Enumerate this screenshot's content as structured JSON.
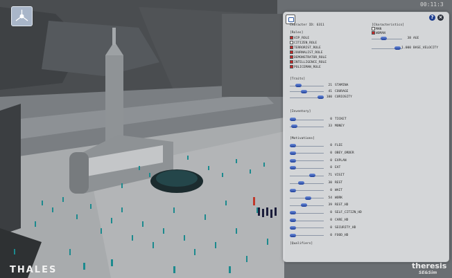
{
  "overlay": {
    "clock": "00:11:3",
    "bottom_left_logo": "THALES",
    "bottom_right_logo": "theresis",
    "bottom_right_sub": "SE&Sim"
  },
  "panel": {
    "character_id": "Character ID: 6311",
    "help_icon": "?",
    "close_icon": "×",
    "roles_header": "[Roles]",
    "roles": [
      {
        "label": "VIP_ROLE",
        "checked": true
      },
      {
        "label": "CITIZEN_ROLE",
        "checked": false
      },
      {
        "label": "TERRORIST_ROLE",
        "checked": true
      },
      {
        "label": "JOURNALIST_ROLE",
        "checked": true
      },
      {
        "label": "DEMONSTRATOR_ROLE",
        "checked": true
      },
      {
        "label": "INTELLIGENCE_ROLE",
        "checked": true
      },
      {
        "label": "POLICEMAN_ROLE",
        "checked": true
      }
    ],
    "characteristics_header": "[Characteristics]",
    "genders": [
      {
        "label": "MAN",
        "checked": false
      },
      {
        "label": "WOMAN",
        "checked": true
      }
    ],
    "characteristics": [
      {
        "label": "AGE",
        "value": "38",
        "level": 0.38
      },
      {
        "label": "BASE_VELOCITY",
        "value": "1.000",
        "level": 0.95
      }
    ],
    "traits_header": "[Traits]",
    "traits": [
      {
        "label": "STAMINA",
        "value": "21",
        "level": 0.21
      },
      {
        "label": "COURAGE",
        "value": "41",
        "level": 0.41
      },
      {
        "label": "CURIOSITY",
        "value": "100",
        "level": 1.0
      }
    ],
    "inventory_header": "[Inventory]",
    "inventory": [
      {
        "label": "TICKET",
        "value": "0",
        "level": 0.0
      },
      {
        "label": "MONEY",
        "value": "33",
        "level": 0.05
      }
    ],
    "motivations_header": "[Motivations]",
    "motivations": [
      {
        "label": "FLEE",
        "value": "0",
        "level": 0.0
      },
      {
        "label": "OBEY_ORDER",
        "value": "0",
        "level": 0.0
      },
      {
        "label": "EXPLAN",
        "value": "0",
        "level": 0.0
      },
      {
        "label": "EAT",
        "value": "0",
        "level": 0.0
      },
      {
        "label": "VISIT",
        "value": "71",
        "level": 0.71
      },
      {
        "label": "REST",
        "value": "30",
        "level": 0.3
      },
      {
        "label": "WAIT",
        "value": "0",
        "level": 0.0
      },
      {
        "label": "WORK",
        "value": "54",
        "level": 0.54
      },
      {
        "label": "REST_HD",
        "value": "39",
        "level": 0.39
      },
      {
        "label": "SELF_CITIZN_HD",
        "value": "0",
        "level": 0.0
      },
      {
        "label": "CARE_HD",
        "value": "0",
        "level": 0.0
      },
      {
        "label": "SECURITY_HD",
        "value": "0",
        "level": 0.0
      },
      {
        "label": "FOOD_HD",
        "value": "0",
        "level": 0.0
      }
    ],
    "qualifiers_header": "[Qualifiers]"
  }
}
